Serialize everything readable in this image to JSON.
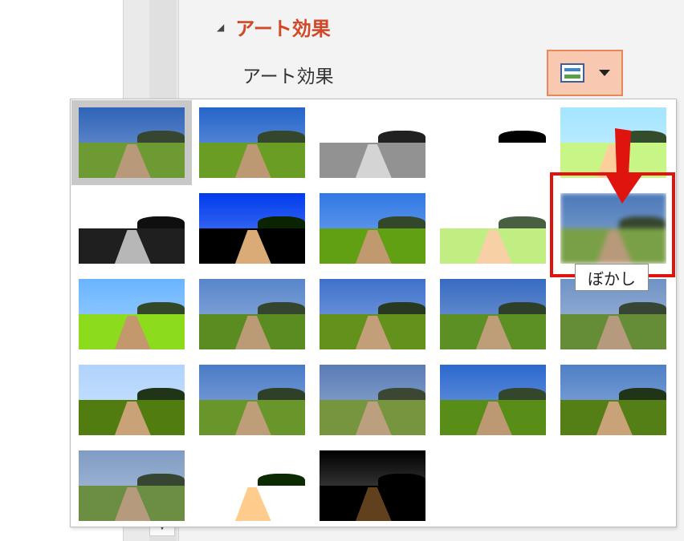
{
  "panel": {
    "section_title": "アート効果",
    "row_label": "アート効果",
    "expand_icon": "collapse-triangle-icon",
    "button_icon": "art-effects-icon",
    "dropdown_icon": "dropdown-arrow-icon"
  },
  "gallery": {
    "tooltip": "ぼかし",
    "selected_index": 0,
    "highlight_index": 9,
    "items": [
      {
        "effect": "none",
        "sky": "#2f64b8",
        "field": "#6e9a34",
        "filter": "none"
      },
      {
        "effect": "marker",
        "sky": "#2f64b8",
        "field": "#6e9a34",
        "filter": "saturate(1.2)"
      },
      {
        "effect": "pencil-grayscale",
        "sky": "#cfcfcf",
        "field": "#7c7c7c",
        "filter": "grayscale(1) contrast(1.6) brightness(1.2)"
      },
      {
        "effect": "pencil-sketch",
        "sky": "#f2f2f2",
        "field": "#bdbdbd",
        "filter": "grayscale(1) contrast(2.2) brightness(1.7)"
      },
      {
        "effect": "line-drawing",
        "sky": "#7fa8db",
        "field": "#95b36c",
        "filter": "contrast(1.2) brightness(1.3)"
      },
      {
        "effect": "chalk-sketch",
        "sky": "#f0f0f0",
        "field": "#4a4a4a",
        "filter": "grayscale(1) contrast(1.8)"
      },
      {
        "effect": "paint-strokes",
        "sky": "#1e55c4",
        "field": "#1d2c12",
        "filter": "contrast(1.6)"
      },
      {
        "effect": "paint-brush",
        "sky": "#3f76c9",
        "field": "#6a9a2e",
        "filter": "saturate(1.3)"
      },
      {
        "effect": "glow-diffused",
        "sky": "#e8eef6",
        "field": "#8fb060",
        "filter": "brightness(1.35)"
      },
      {
        "effect": "blur",
        "sky": "#4a78b9",
        "field": "#79a047",
        "filter": "blur(3px)"
      },
      {
        "effect": "light-screen",
        "sky": "#7db2e8",
        "field": "#9ad24a",
        "filter": "saturate(1.4)"
      },
      {
        "effect": "watercolor-sponge",
        "sky": "#5c86c4",
        "field": "#5d8a2a",
        "filter": "saturate(1.1)"
      },
      {
        "effect": "film-grain",
        "sky": "#4a74c0",
        "field": "#678f2d",
        "filter": "contrast(1.2)"
      },
      {
        "effect": "mosaic-bubbles",
        "sky": "#3e6dbb",
        "field": "#5f8e2c",
        "filter": "contrast(1.1)"
      },
      {
        "effect": "glass",
        "sky": "#6d93cc",
        "field": "#628f30",
        "filter": "saturate(0.9)"
      },
      {
        "effect": "cement",
        "sky": "#a5c0e0",
        "field": "#5c7d2a",
        "filter": "contrast(1.3)"
      },
      {
        "effect": "texturizer",
        "sky": "#4f7bc1",
        "field": "#6b9432",
        "filter": "contrast(1.1)"
      },
      {
        "effect": "crisscross-etching",
        "sky": "#4d7ac3",
        "field": "#6d9535",
        "filter": "sepia(0.15)"
      },
      {
        "effect": "pastels-smooth",
        "sky": "#3568bc",
        "field": "#5e8a27",
        "filter": "saturate(1.2)"
      },
      {
        "effect": "plastic-wrap",
        "sky": "#5a7fb6",
        "field": "#5d7f2e",
        "filter": "contrast(1.3)"
      },
      {
        "effect": "cutout",
        "sky": "#7d9cc9",
        "field": "#6a8f3b",
        "filter": "saturate(0.9)"
      },
      {
        "effect": "photocopy",
        "sky": "#f4f7f2",
        "field": "#d7e0c8",
        "filter": "contrast(1.6) brightness(1.2)"
      },
      {
        "effect": "glow-edges",
        "sky": "#0d0d10",
        "field": "#1f2714",
        "filter": "brightness(0.6) contrast(1.8)"
      }
    ]
  },
  "colors": {
    "accent": "#d24726",
    "highlight": "#e0140f",
    "button_bg": "#f8c9b0",
    "button_border": "#e8865e"
  }
}
